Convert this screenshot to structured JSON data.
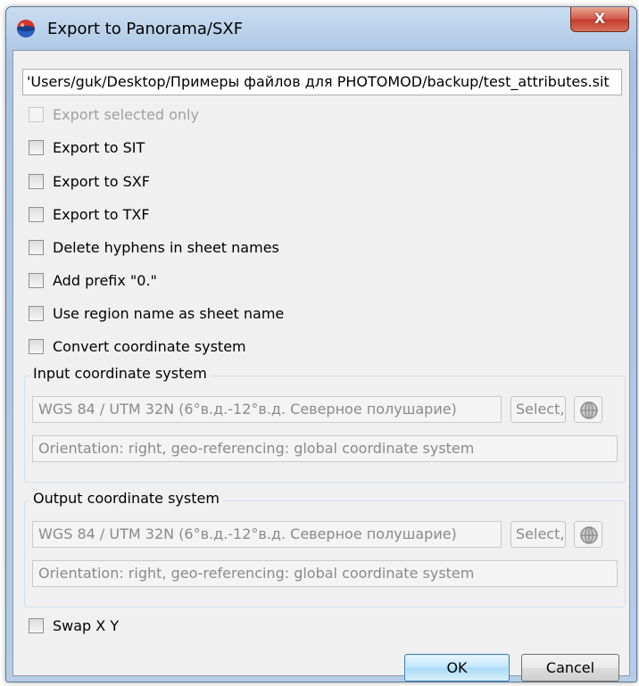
{
  "window": {
    "title": "Export to Panorama/SXF",
    "close_label": "X"
  },
  "path_field": {
    "value": "'Users/guk/Desktop/Примеры файлов для PHOTOMOD/backup/test_attributes.sit"
  },
  "options": {
    "export_selected_only": {
      "label": "Export selected only",
      "checked": false,
      "enabled": false
    },
    "export_to_sit": {
      "label": "Export to SIT",
      "checked": false
    },
    "export_to_sxf": {
      "label": "Export to SXF",
      "checked": false
    },
    "export_to_txf": {
      "label": "Export to TXF",
      "checked": false
    },
    "delete_hyphens": {
      "label": "Delete hyphens in sheet names",
      "checked": false
    },
    "add_prefix": {
      "label": "Add prefix \"0.\"",
      "checked": false
    },
    "use_region_name": {
      "label": "Use region name as sheet name",
      "checked": false
    },
    "convert_cs": {
      "label": "Convert coordinate system",
      "checked": false
    }
  },
  "input_cs": {
    "title": "Input coordinate system",
    "value": "WGS 84 / UTM 32N (6°в.д.-12°в.д. Северное полушарие)",
    "select_label": "Select,",
    "orientation": "Orientation: right, geo-referencing: global coordinate system"
  },
  "output_cs": {
    "title": "Output coordinate system",
    "value": "WGS 84 / UTM 32N (6°в.д.-12°в.д. Северное полушарие)",
    "select_label": "Select,",
    "orientation": "Orientation: right, geo-referencing: global coordinate system"
  },
  "swap_xy": {
    "label": "Swap X Y",
    "checked": false
  },
  "buttons": {
    "ok": "OK",
    "cancel": "Cancel"
  },
  "icons": {
    "app": "panorama-app-icon",
    "globe": "globe-icon"
  },
  "colors": {
    "title_bar": "#b5cde6",
    "close_button": "#c33b2c",
    "ok_border": "#3c7fb1",
    "disabled_text": "#a0a0a0"
  }
}
